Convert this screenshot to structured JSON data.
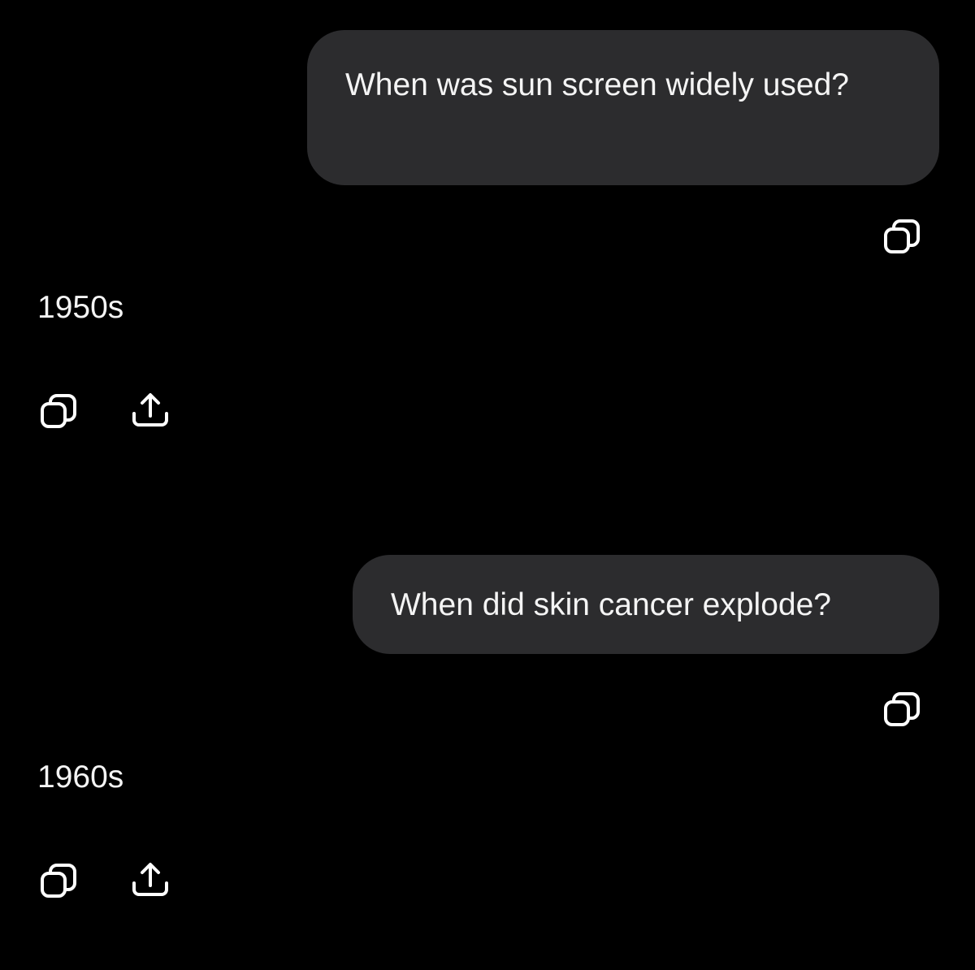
{
  "conversation": [
    {
      "user_message": "When was sun screen widely used?",
      "user_copy_icon": "copy-icon",
      "reply": "1950s",
      "reply_actions": [
        "copy-icon",
        "share-icon"
      ]
    },
    {
      "user_message": "When did skin cancer explode?",
      "user_copy_icon": "copy-icon",
      "reply": "1960s",
      "reply_actions": [
        "copy-icon",
        "share-icon"
      ]
    }
  ],
  "colors": {
    "background": "#000000",
    "bubble": "#2c2c2e",
    "text": "#f4f4f4",
    "icon": "#ffffff"
  }
}
